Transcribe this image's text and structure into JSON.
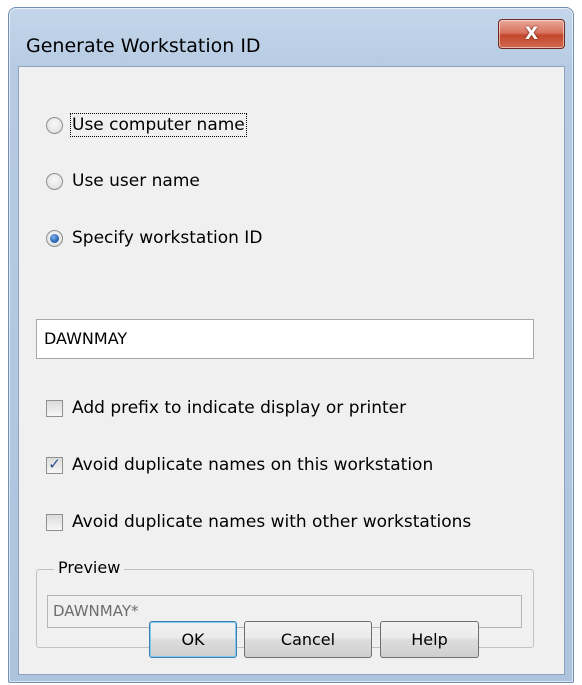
{
  "dialog": {
    "title": "Generate Workstation ID",
    "close_label": "X"
  },
  "options": {
    "radio_computer_name": {
      "label": "Use computer name",
      "selected": false
    },
    "radio_user_name": {
      "label": "Use user name",
      "selected": false
    },
    "radio_specify": {
      "label": "Specify workstation ID",
      "selected": true
    },
    "workstation_id_value": "DAWNMAY",
    "checkbox_prefix": {
      "label": "Add prefix to indicate display or printer",
      "checked": false
    },
    "checkbox_avoid_this": {
      "label": "Avoid duplicate names on this workstation",
      "checked": true
    },
    "checkbox_avoid_other": {
      "label": "Avoid duplicate names with other workstations",
      "checked": false
    }
  },
  "preview": {
    "group_label": "Preview",
    "value": "DAWNMAY*"
  },
  "buttons": {
    "ok": "OK",
    "cancel": "Cancel",
    "help": "Help"
  },
  "colors": {
    "accent_radio": "#2a67b8",
    "close_button": "#c2462c",
    "window_frame": "#b6cbe3",
    "client_background": "#f0f0f0"
  }
}
